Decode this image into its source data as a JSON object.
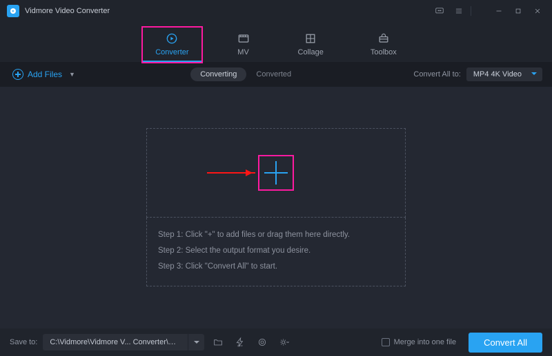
{
  "titlebar": {
    "app_name": "Vidmore Video Converter"
  },
  "nav": {
    "items": [
      {
        "label": "Converter"
      },
      {
        "label": "MV"
      },
      {
        "label": "Collage"
      },
      {
        "label": "Toolbox"
      }
    ]
  },
  "subbar": {
    "add_label": "Add Files",
    "segments": {
      "converting": "Converting",
      "converted": "Converted"
    },
    "convert_all_label": "Convert All to:",
    "format_value": "MP4 4K Video"
  },
  "dropzone": {
    "step1": "Step 1: Click \"+\" to add files or drag them here directly.",
    "step2": "Step 2: Select the output format you desire.",
    "step3": "Step 3: Click \"Convert All\" to start."
  },
  "footer": {
    "save_to_label": "Save to:",
    "path": "C:\\Vidmore\\Vidmore V... Converter\\Converted",
    "merge_label": "Merge into one file",
    "convert_label": "Convert All"
  }
}
